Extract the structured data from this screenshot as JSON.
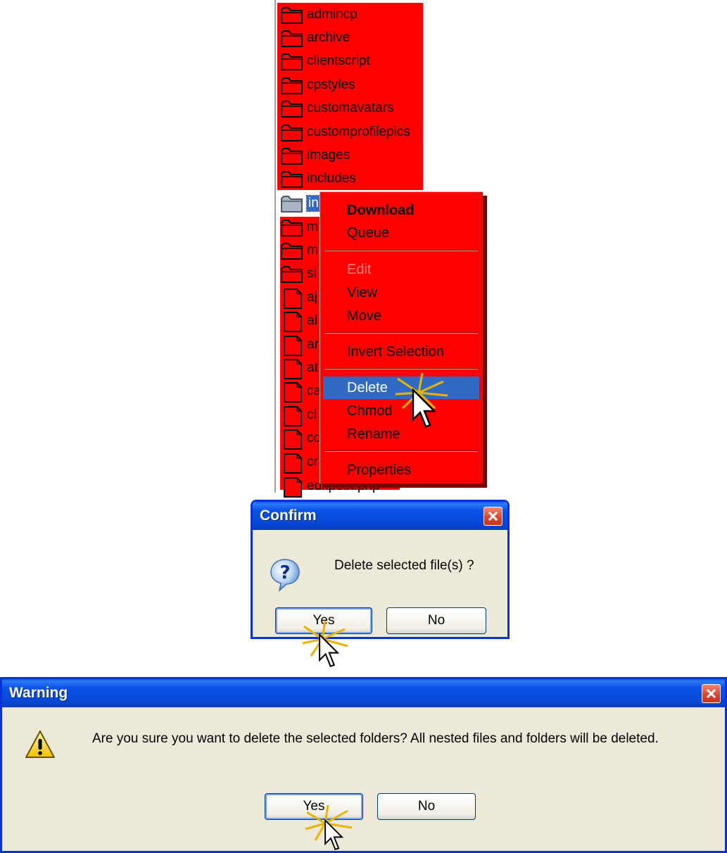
{
  "file_list": {
    "folders_top": [
      "admincp",
      "archive",
      "clientscript",
      "cpstyles",
      "customavatars",
      "customprofilepics",
      "images",
      "includes"
    ],
    "selected_item_visible": "in",
    "partial_rows": [
      "m",
      "m",
      "si",
      "aj",
      "al",
      "ar",
      "at",
      "ca",
      "cl",
      "co",
      "cr"
    ],
    "last_row_partial": "editpost.php"
  },
  "context_menu": {
    "items": [
      {
        "label": "Download",
        "bold": true
      },
      {
        "label": "Queue"
      },
      {
        "label": "Edit",
        "disabled": true
      },
      {
        "label": "View"
      },
      {
        "label": "Move"
      },
      {
        "label": "Invert Selection"
      },
      {
        "label": "Delete",
        "active": true
      },
      {
        "label": "Chmod"
      },
      {
        "label": "Rename"
      },
      {
        "label": "Properties"
      }
    ]
  },
  "confirm_dialog": {
    "title": "Confirm",
    "icon": "question-icon",
    "message": "Delete selected file(s) ?",
    "yes_label": "Yes",
    "no_label": "No"
  },
  "warning_dialog": {
    "title": "Warning",
    "icon": "warning-icon",
    "message": "Are you sure you want to delete the selected folders?  All nested files and folders will be deleted.",
    "yes_label": "Yes",
    "no_label": "No"
  },
  "colors": {
    "highlight": "#ff0000",
    "selection": "#316ac5",
    "xp_title": "#0a53e8",
    "dialog_face": "#ece9d8"
  }
}
